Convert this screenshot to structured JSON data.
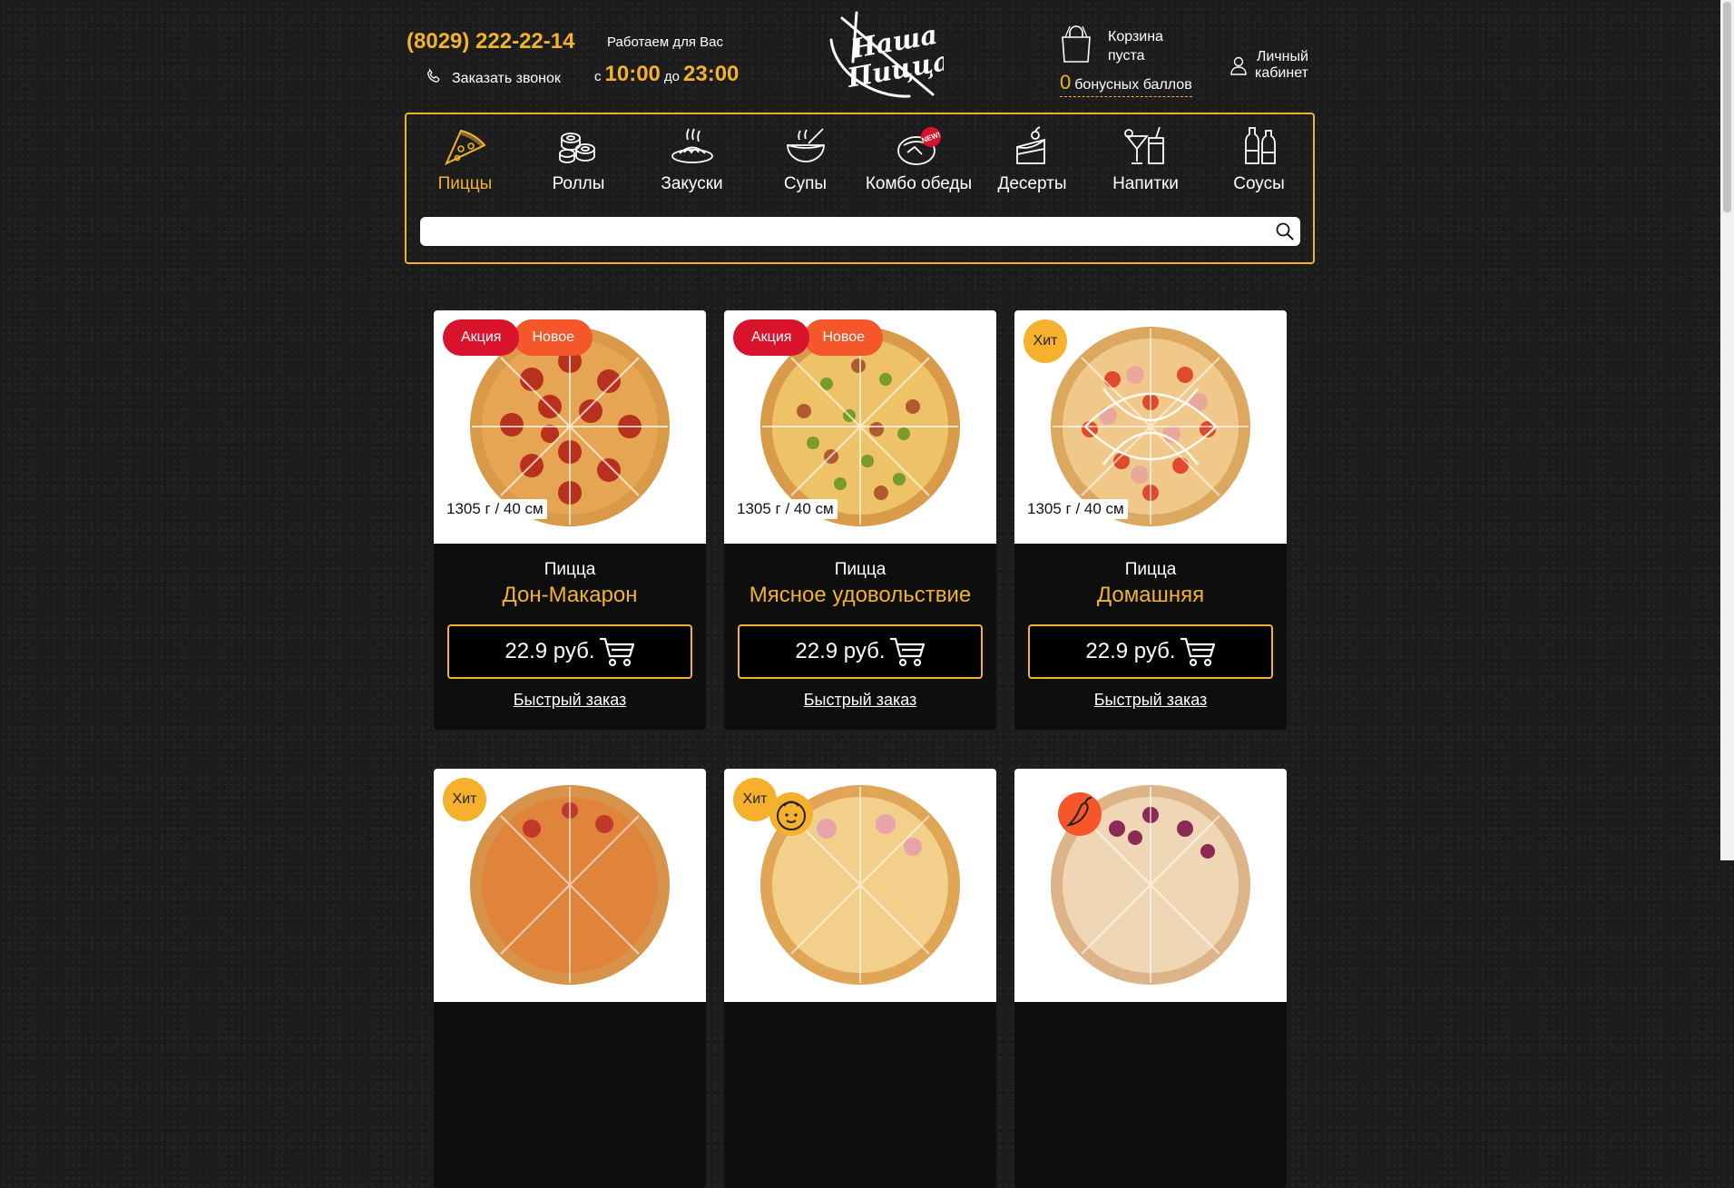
{
  "header": {
    "phone": "(8029) 222-22-14",
    "callback_label": "Заказать звонок",
    "workhours_label": "Работаем для Вас",
    "hours_from_prefix": "с",
    "hours_from": "10:00",
    "hours_to_prefix": "до",
    "hours_to": "23:00",
    "logo_line1": "Наша",
    "logo_line2": "Пицца",
    "cart_line1": "Корзина",
    "cart_line2": "пуста",
    "bonus_count": "0",
    "bonus_label": "бонусных баллов",
    "account_line1": "Личный",
    "account_line2": "кабинет"
  },
  "menu": {
    "items": [
      {
        "label": "Пиццы",
        "icon": "pizza-slice-icon"
      },
      {
        "label": "Роллы",
        "icon": "rolls-icon"
      },
      {
        "label": "Закуски",
        "icon": "snacks-icon"
      },
      {
        "label": "Супы",
        "icon": "soup-icon"
      },
      {
        "label": "Комбо обеды",
        "icon": "combo-new-icon",
        "badge": "NEW!"
      },
      {
        "label": "Десерты",
        "icon": "cake-icon"
      },
      {
        "label": "Напитки",
        "icon": "drinks-icon"
      },
      {
        "label": "Соусы",
        "icon": "sauces-icon"
      }
    ],
    "search_placeholder": ""
  },
  "products": [
    {
      "badges": [
        "Акция",
        "Новое"
      ],
      "weight": "1305 г / 40 см",
      "kind": "Пицца",
      "title": "Дон-Макарон",
      "price": "22.9 руб.",
      "quick": "Быстрый заказ"
    },
    {
      "badges": [
        "Акция",
        "Новое"
      ],
      "weight": "1305 г / 40 см",
      "kind": "Пицца",
      "title": "Мясное удовольствие",
      "price": "22.9 руб.",
      "quick": "Быстрый заказ"
    },
    {
      "badges": [
        "Хит"
      ],
      "weight": "1305 г / 40 см",
      "kind": "Пицца",
      "title": "Домашняя",
      "price": "22.9 руб.",
      "quick": "Быстрый заказ"
    },
    {
      "badges": [
        "Хит"
      ]
    },
    {
      "badges": [
        "Хит"
      ],
      "extra_icon": "baby-face-icon"
    },
    {
      "badges": [],
      "extra_icon": "chili-pepper-icon"
    }
  ],
  "colors": {
    "accent": "#f2b230",
    "sale": "#d9132b",
    "new": "#f5572a",
    "hit": "#f5b12e",
    "background": "#1c1c1c"
  }
}
